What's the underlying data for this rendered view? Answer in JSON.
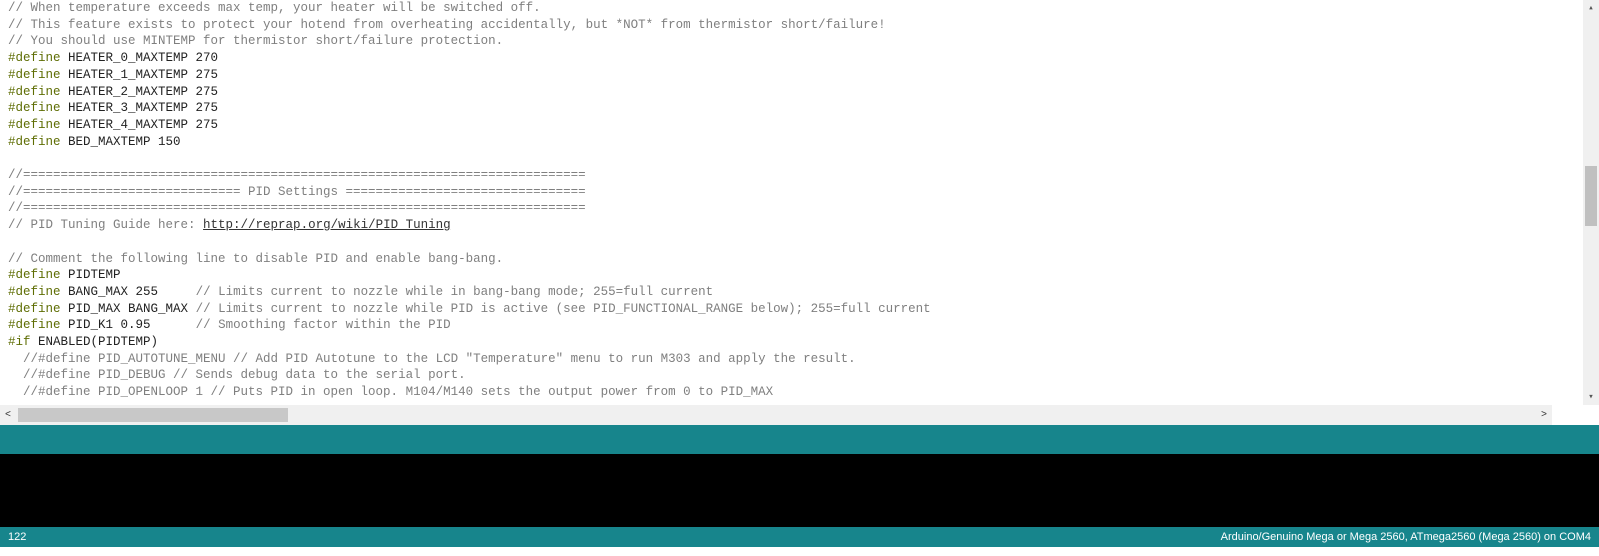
{
  "code": {
    "c1": "// When temperature exceeds max temp, your heater will be switched off.",
    "c2": "// This feature exists to protect your hotend from overheating accidentally, but *NOT* from thermistor short/failure!",
    "c3": "// You should use MINTEMP for thermistor short/failure protection.",
    "d1k": "#define",
    "d1": "HEATER_0_MAXTEMP 270",
    "d2k": "#define",
    "d2": "HEATER_1_MAXTEMP 275",
    "d3k": "#define",
    "d3": "HEATER_2_MAXTEMP 275",
    "d4k": "#define",
    "d4": "HEATER_3_MAXTEMP 275",
    "d5k": "#define",
    "d5": "HEATER_4_MAXTEMP 275",
    "d6k": "#define",
    "d6": "BED_MAXTEMP 150",
    "sep1": "//===========================================================================",
    "sep2": "//============================= PID Settings ================================",
    "sep3": "//===========================================================================",
    "guidepre": "// PID Tuning Guide here: ",
    "guideurl": "http://reprap.org/wiki/PID_Tuning",
    "c4": "// Comment the following line to disable PID and enable bang-bang.",
    "d7k": "#define",
    "d7": "PIDTEMP",
    "d8k": "#define",
    "d8": "BANG_MAX 255     ",
    "d8c": "// Limits current to nozzle while in bang-bang mode; 255=full current",
    "d9k": "#define",
    "d9": "PID_MAX BANG_MAX ",
    "d9c": "// Limits current to nozzle while PID is active (see PID_FUNCTIONAL_RANGE below); 255=full current",
    "d10k": "#define",
    "d10": "PID_K1 0.95      ",
    "d10c": "// Smoothing factor within the PID",
    "ifk": "#if",
    "ifv": " ENABLED(PIDTEMP)",
    "cc1": "  //#define PID_AUTOTUNE_MENU // Add PID Autotune to the LCD \"Temperature\" menu to run M303 and apply the result.",
    "cc2": "  //#define PID_DEBUG // Sends debug data to the serial port.",
    "cc3": "  //#define PID_OPENLOOP 1 // Puts PID in open loop. M104/M140 sets the output power from 0 to PID_MAX"
  },
  "status": {
    "line": "122",
    "board": "Arduino/Genuino Mega or Mega 2560, ATmega2560 (Mega 2560) on COM4"
  },
  "h_scroll": {
    "left": "<",
    "right": ">"
  },
  "v_scroll": {
    "up": "▴",
    "down": "▾"
  }
}
